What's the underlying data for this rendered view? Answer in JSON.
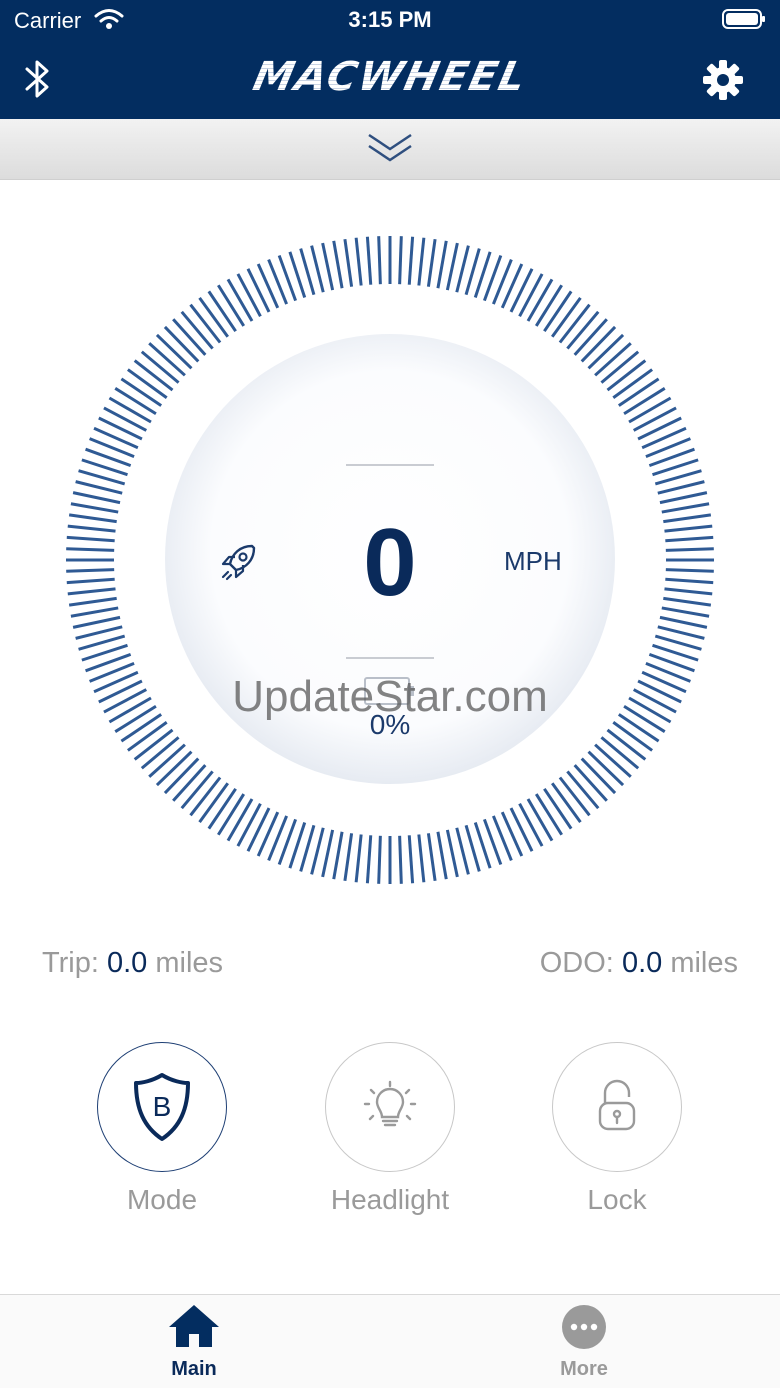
{
  "status_bar": {
    "carrier": "Carrier",
    "time": "3:15 PM"
  },
  "header": {
    "logo_text": "MACWHEEL"
  },
  "gauge": {
    "speed": "0",
    "unit": "MPH",
    "battery": "0%"
  },
  "watermark": "UpdateStar.com",
  "stats": {
    "trip_label": "Trip:",
    "trip_value": "0.0",
    "trip_unit": "miles",
    "odo_label": "ODO:",
    "odo_value": "0.0",
    "odo_unit": "miles"
  },
  "controls": [
    {
      "label": "Mode",
      "icon": "shield-b-icon",
      "active": true
    },
    {
      "label": "Headlight",
      "icon": "lightbulb-icon",
      "active": false
    },
    {
      "label": "Lock",
      "icon": "lock-icon",
      "active": false
    }
  ],
  "tabs": [
    {
      "label": "Main",
      "icon": "home-icon",
      "selected": true
    },
    {
      "label": "More",
      "icon": "more-icon",
      "selected": false
    }
  ],
  "colors": {
    "header_bg": "#032d60",
    "accent": "#0a2a5a",
    "tick": "#2f5a94",
    "muted": "#9a9a9a"
  }
}
